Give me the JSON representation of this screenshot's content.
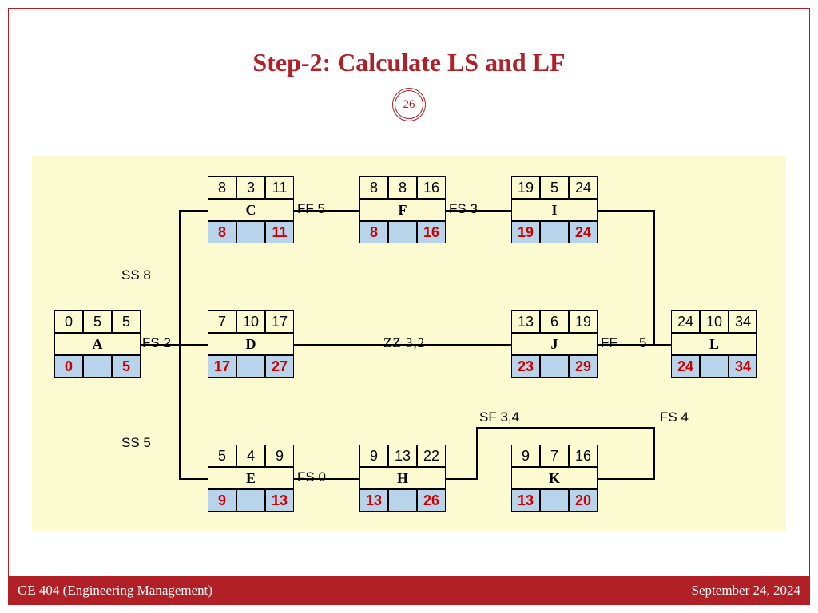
{
  "title": "Step-2: Calculate LS and LF",
  "pageNum": "26",
  "footerLeft": "GE 404 (Engineering Management)",
  "footerRight": "September 24, 2024",
  "acts": {
    "A": {
      "es": "0",
      "d": "5",
      "ef": "5",
      "name": "A",
      "ls": "0",
      "lf": "5"
    },
    "C": {
      "es": "8",
      "d": "3",
      "ef": "11",
      "name": "C",
      "ls": "8",
      "lf": "11"
    },
    "D": {
      "es": "7",
      "d": "10",
      "ef": "17",
      "name": "D",
      "ls": "17",
      "lf": "27"
    },
    "E": {
      "es": "5",
      "d": "4",
      "ef": "9",
      "name": "E",
      "ls": "9",
      "lf": "13"
    },
    "F": {
      "es": "8",
      "d": "8",
      "ef": "16",
      "name": "F",
      "ls": "8",
      "lf": "16"
    },
    "H": {
      "es": "9",
      "d": "13",
      "ef": "22",
      "name": "H",
      "ls": "13",
      "lf": "26"
    },
    "I": {
      "es": "19",
      "d": "5",
      "ef": "24",
      "name": "I",
      "ls": "19",
      "lf": "24"
    },
    "J": {
      "es": "13",
      "d": "6",
      "ef": "19",
      "name": "J",
      "ls": "23",
      "lf": "29"
    },
    "K": {
      "es": "9",
      "d": "7",
      "ef": "16",
      "name": "K",
      "ls": "13",
      "lf": "20"
    },
    "L": {
      "es": "24",
      "d": "10",
      "ef": "34",
      "name": "L",
      "ls": "24",
      "lf": "34"
    }
  },
  "rels": {
    "FS2": "FS 2",
    "SS8": "SS 8",
    "SS5": "SS 5",
    "FF5": "FF 5",
    "FS0": "FS 0",
    "FS3": "FS 3",
    "ZZ": "ZZ 3,2",
    "SF34": "SF 3,4",
    "FF": "FF",
    "five": "5",
    "FS4": "FS 4"
  }
}
